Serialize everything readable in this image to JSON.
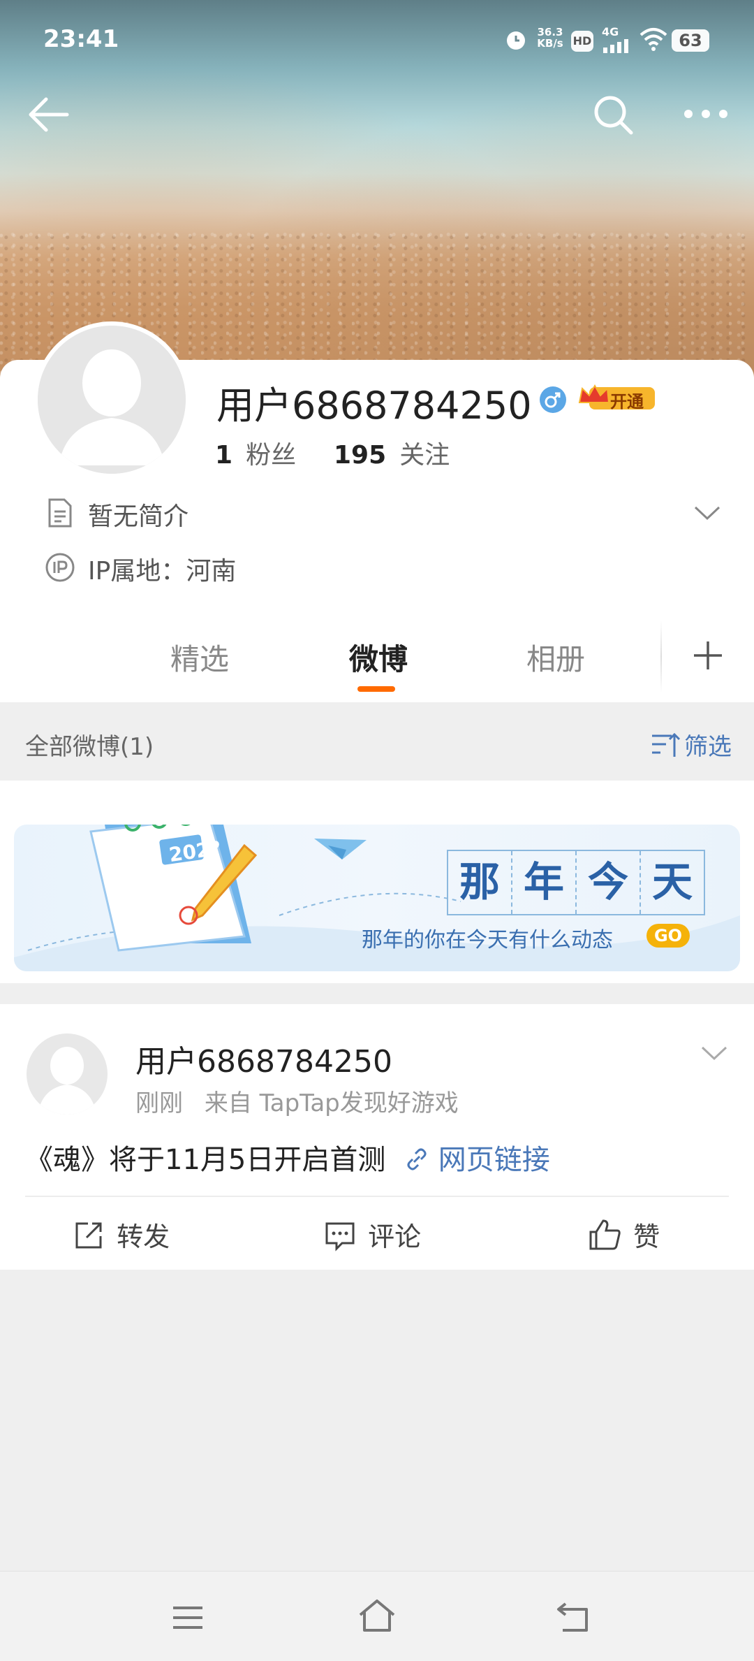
{
  "status_bar": {
    "time": "23:41",
    "net_speed_value": "36.3",
    "net_speed_unit": "KB/s",
    "hd": "HD",
    "network": "4G",
    "battery": "63"
  },
  "profile": {
    "username": "用户6868784250",
    "vip_label": "开通",
    "followers_count": "1",
    "followers_label": "粉丝",
    "following_count": "195",
    "following_label": "关注",
    "bio": "暂无简介",
    "ip_label": "IP属地：河南"
  },
  "tabs": [
    {
      "label": "精选"
    },
    {
      "label": "微博"
    },
    {
      "label": "相册"
    }
  ],
  "feed_header": {
    "title": "全部微博(1)",
    "filter_label": "筛选"
  },
  "on_this_day": {
    "calendar_year": "202?",
    "title_chars": [
      "那",
      "年",
      "今",
      "天"
    ],
    "subtitle": "那年的你在今天有什么动态",
    "go_label": "GO"
  },
  "post": {
    "author": "用户6868784250",
    "time": "刚刚",
    "source": "来自 TapTap发现好游戏",
    "text": "《魂》将于11月5日开启首测",
    "link_label": "网页链接",
    "actions": {
      "repost": "转发",
      "comment": "评论",
      "like": "赞"
    }
  },
  "colors": {
    "accent": "#ff6a00",
    "link": "#4a78b8",
    "vip_gold": "#f7b52c",
    "male_badge": "#5ba7e6"
  }
}
